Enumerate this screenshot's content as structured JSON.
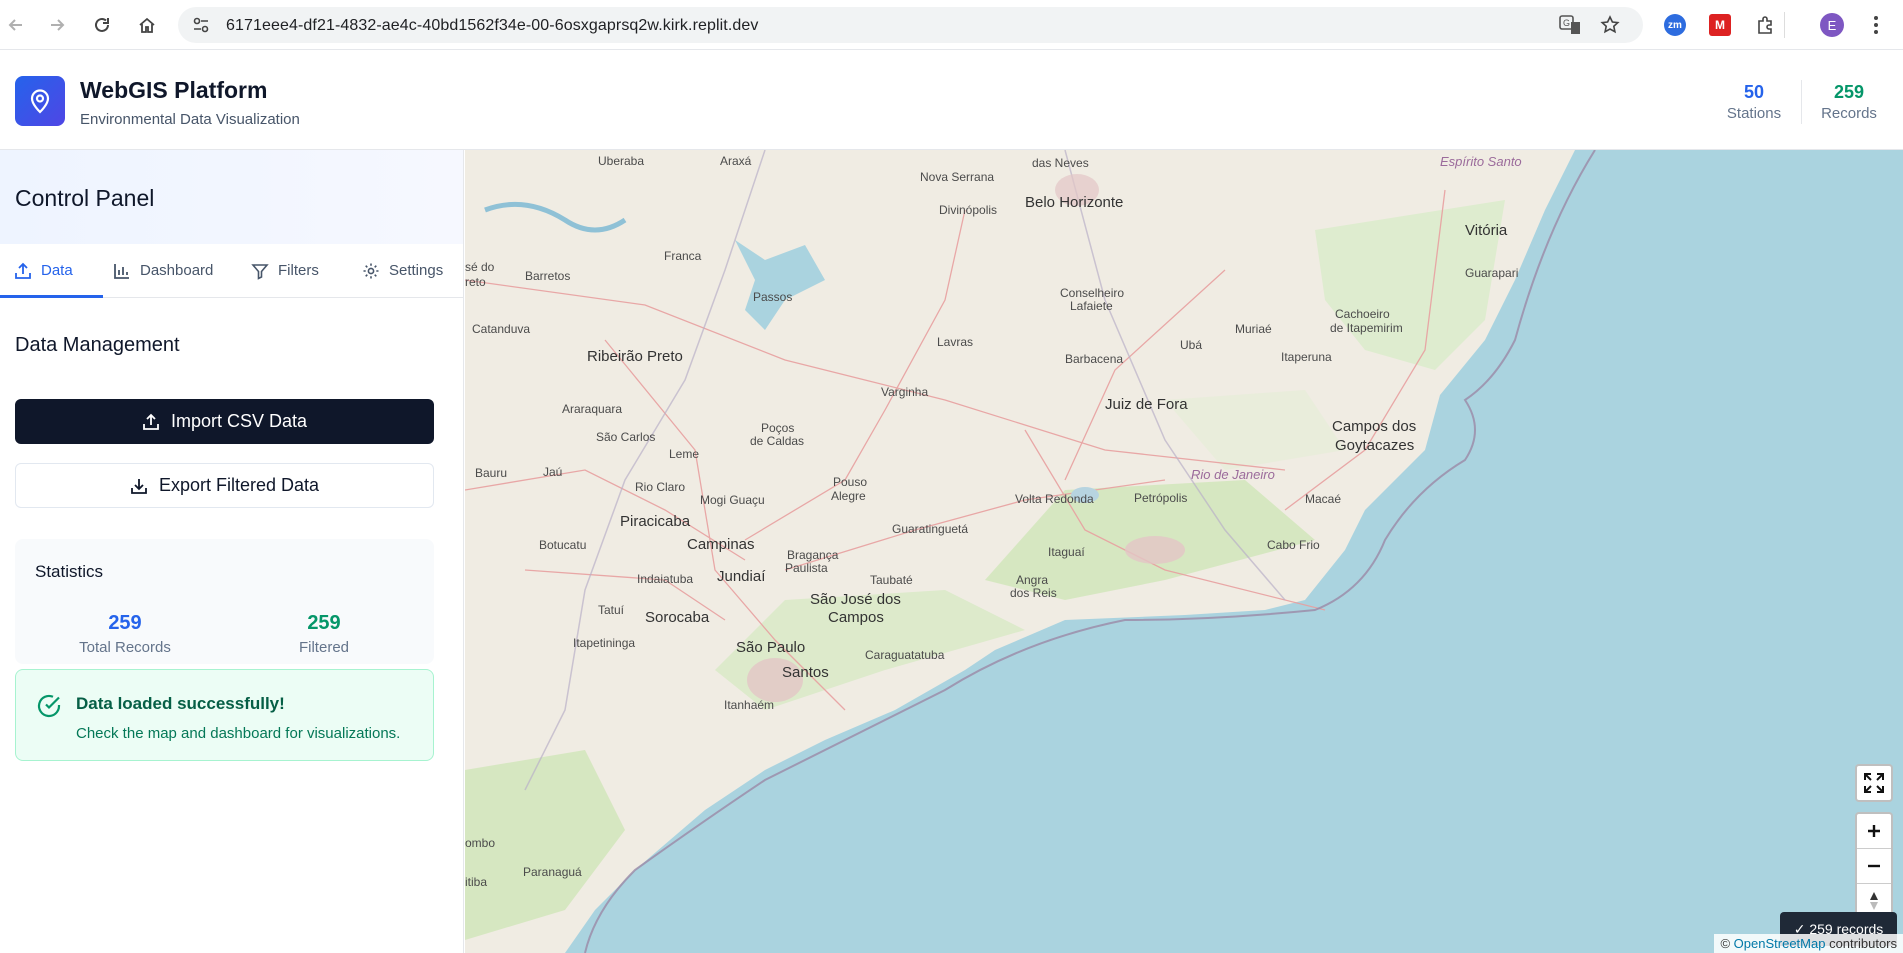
{
  "browser": {
    "url": "6171eee4-df21-4832-ae4c-40bd1562f34e-00-6osxgaprsq2w.kirk.replit.dev",
    "profile_initial": "E"
  },
  "header": {
    "title": "WebGIS Platform",
    "subtitle": "Environmental Data Visualization",
    "stations_value": "50",
    "stations_label": "Stations",
    "records_value": "259",
    "records_label": "Records",
    "accent_blue": "#2563eb",
    "accent_green": "#059669"
  },
  "sidebar": {
    "panel_title": "Control Panel",
    "tabs": [
      {
        "label": "Data",
        "icon": "upload-icon",
        "active": true
      },
      {
        "label": "Dashboard",
        "icon": "bar-chart-icon",
        "active": false
      },
      {
        "label": "Filters",
        "icon": "filter-icon",
        "active": false
      },
      {
        "label": "Settings",
        "icon": "gear-icon",
        "active": false
      }
    ],
    "section_title": "Data Management",
    "import_label": "Import CSV Data",
    "export_label": "Export Filtered Data",
    "statistics": {
      "title": "Statistics",
      "total_value": "259",
      "total_label": "Total Records",
      "filtered_value": "259",
      "filtered_label": "Filtered"
    },
    "alert": {
      "title": "Data loaded successfully!",
      "message": "Check the map and dashboard for visualizations."
    }
  },
  "map": {
    "badge": "✓ 259 records",
    "attribution_symbol": "©",
    "attribution_link": "OpenStreetMap",
    "attribution_rest": "contributors",
    "labels": [
      {
        "text": "Uberaba"
      },
      {
        "text": "Araxá"
      },
      {
        "text": "das Neves"
      },
      {
        "text": "Nova Serrana"
      },
      {
        "text": "Espírito Santo"
      },
      {
        "text": "Divinópolis"
      },
      {
        "text": "Belo Horizonte"
      },
      {
        "text": "Vitória"
      },
      {
        "text": "Franca"
      },
      {
        "text": "Barretos"
      },
      {
        "text": "Guarapari"
      },
      {
        "text": "Passos"
      },
      {
        "text": "Conselheiro"
      },
      {
        "text": "Lafaiete"
      },
      {
        "text": "Cachoeiro"
      },
      {
        "text": "de Itapemirim"
      },
      {
        "text": "Catanduva"
      },
      {
        "text": "Muriaé"
      },
      {
        "text": "Lavras"
      },
      {
        "text": "Ubá"
      },
      {
        "text": "Itaperuna"
      },
      {
        "text": "Ribeirão Preto"
      },
      {
        "text": "Barbacena"
      },
      {
        "text": "Varginha"
      },
      {
        "text": "Araraquara"
      },
      {
        "text": "Juiz de Fora"
      },
      {
        "text": "Poços"
      },
      {
        "text": "de Caldas"
      },
      {
        "text": "Campos dos"
      },
      {
        "text": "Goytacazes"
      },
      {
        "text": "São Carlos"
      },
      {
        "text": "Leme"
      },
      {
        "text": "Bauru"
      },
      {
        "text": "Jaú"
      },
      {
        "text": "Rio de Janeiro"
      },
      {
        "text": "Pouso"
      },
      {
        "text": "Alegre"
      },
      {
        "text": "Rio Claro"
      },
      {
        "text": "Mogi Guaçu"
      },
      {
        "text": "Volta Redonda"
      },
      {
        "text": "Petrópolis"
      },
      {
        "text": "Macaé"
      },
      {
        "text": "Piracicaba"
      },
      {
        "text": "Guaratinguetá"
      },
      {
        "text": "Campinas"
      },
      {
        "text": "Botucatu"
      },
      {
        "text": "Itaguaí"
      },
      {
        "text": "Cabo Frio"
      },
      {
        "text": "Bragança"
      },
      {
        "text": "Paulista"
      },
      {
        "text": "Indaiatuba"
      },
      {
        "text": "Jundiaí"
      },
      {
        "text": "Taubaté"
      },
      {
        "text": "Angra"
      },
      {
        "text": "dos Reis"
      },
      {
        "text": "São José dos"
      },
      {
        "text": "Campos"
      },
      {
        "text": "Sorocaba"
      },
      {
        "text": "Tatuí"
      },
      {
        "text": "Itapetininga"
      },
      {
        "text": "São Paulo"
      },
      {
        "text": "Caraguatatuba"
      },
      {
        "text": "Santos"
      },
      {
        "text": "Itanhaém"
      },
      {
        "text": "Paranaguá"
      },
      {
        "text": "ombo"
      },
      {
        "text": "itiba"
      },
      {
        "text": "sé do"
      },
      {
        "text": "reto"
      }
    ]
  }
}
